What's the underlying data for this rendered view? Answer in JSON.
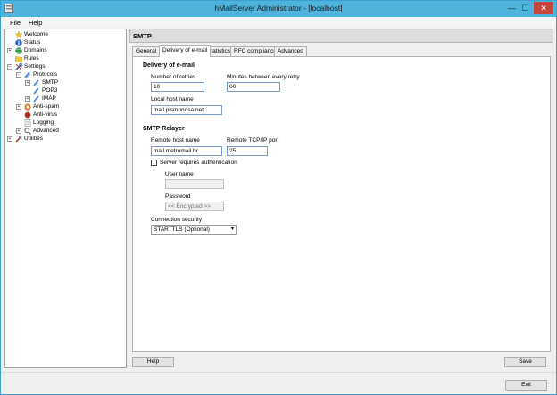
{
  "window": {
    "title": "hMailServer Administrator - [localhost]",
    "min_glyph": "—",
    "max_glyph": "☐",
    "close_glyph": "✕"
  },
  "menu": {
    "file": "File",
    "help": "Help"
  },
  "tree": {
    "expand_plus": "+",
    "expand_minus": "−",
    "items": [
      {
        "label": "Welcome",
        "icon": "star-icon"
      },
      {
        "label": "Status",
        "icon": "info-icon"
      },
      {
        "label": "Domains",
        "icon": "globe-icon"
      },
      {
        "label": "Rules",
        "icon": "folder-icon"
      },
      {
        "label": "Settings",
        "icon": "settings-icon"
      },
      {
        "label": "Protocols",
        "icon": "protocols-icon"
      },
      {
        "label": "SMTP",
        "icon": "protocol-icon"
      },
      {
        "label": "POP3",
        "icon": "protocol-icon"
      },
      {
        "label": "IMAP",
        "icon": "protocol-icon"
      },
      {
        "label": "Anti-spam",
        "icon": "antispam-icon"
      },
      {
        "label": "Anti-virus",
        "icon": "antivirus-icon"
      },
      {
        "label": "Logging",
        "icon": "document-icon"
      },
      {
        "label": "Advanced",
        "icon": "search-icon"
      },
      {
        "label": "Utilities",
        "icon": "tools-icon"
      }
    ]
  },
  "main": {
    "header": "SMTP",
    "tabs": [
      "General",
      "Delivery of e-mail",
      "Statistics",
      "RFC compliance",
      "Advanced"
    ],
    "active_tab": "Delivery of e-mail"
  },
  "delivery": {
    "section_title": "Delivery of e-mail",
    "retries_label": "Number of retries",
    "retries_value": "10",
    "minutes_label": "Minutes between every retry",
    "minutes_value": "60",
    "local_host_label": "Local host name",
    "local_host_value": "mail.pismonosa.net"
  },
  "relayer": {
    "section_title": "SMTP Relayer",
    "remote_host_label": "Remote host name",
    "remote_host_value": "mail.metromail.hr",
    "remote_port_label": "Remote TCP/IP port",
    "remote_port_value": "25",
    "auth_label": "Server requires authentication",
    "auth_checked": false,
    "username_label": "User name",
    "username_value": "",
    "password_label": "Password",
    "password_value": "<< Encrypted >>",
    "security_label": "Connection security",
    "security_value": "STARTTLS (Optional)",
    "dropdown_glyph": "▾"
  },
  "buttons": {
    "help": "Help",
    "save": "Save",
    "exit": "Exit"
  },
  "colors": {
    "titlebar": "#4fb4dc",
    "close_button": "#c7463c",
    "input_border": "#7a9ccf",
    "panel_background": "#f0f0f0"
  }
}
